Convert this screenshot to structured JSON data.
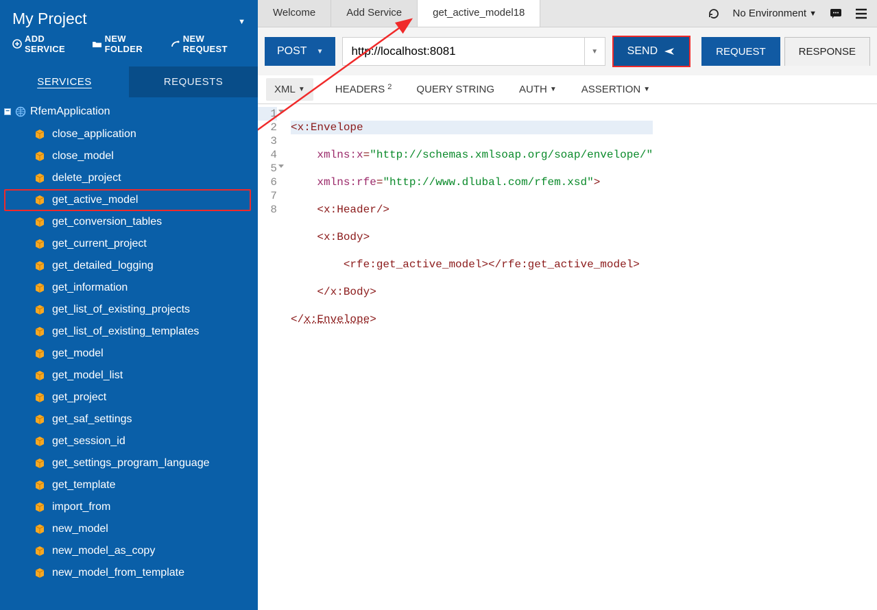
{
  "sidebar": {
    "project_title": "My Project",
    "actions": {
      "add_service": "ADD SERVICE",
      "new_folder": "NEW FOLDER",
      "new_request": "NEW REQUEST"
    },
    "tabs": {
      "services": "SERVICES",
      "requests": "REQUESTS"
    },
    "root": "RfemApplication",
    "items": [
      "close_application",
      "close_model",
      "delete_project",
      "get_active_model",
      "get_conversion_tables",
      "get_current_project",
      "get_detailed_logging",
      "get_information",
      "get_list_of_existing_projects",
      "get_list_of_existing_templates",
      "get_model",
      "get_model_list",
      "get_project",
      "get_saf_settings",
      "get_session_id",
      "get_settings_program_language",
      "get_template",
      "import_from",
      "new_model",
      "new_model_as_copy",
      "new_model_from_template"
    ],
    "highlight_index": 3
  },
  "topbar": {
    "tabs": [
      "Welcome",
      "Add Service",
      "get_active_model18"
    ],
    "active_index": 2,
    "environment": "No Environment"
  },
  "request": {
    "method": "POST",
    "url": "http://localhost:8081",
    "send_label": "SEND",
    "rr_tabs": {
      "request": "REQUEST",
      "response": "RESPONSE"
    },
    "body_tabs": {
      "xml": "XML",
      "headers": "HEADERS",
      "headers_count": "2",
      "query": "QUERY STRING",
      "auth": "AUTH",
      "assertion": "ASSERTION"
    }
  },
  "editor": {
    "lines": {
      "l1a": "<",
      "l1b": "x:Envelope",
      "l2a": "    ",
      "l2b": "xmlns:x",
      "l2c": "=",
      "l2d": "\"http://schemas.xmlsoap.org/soap/envelope/\"",
      "l3a": "    ",
      "l3b": "xmlns:rfe",
      "l3c": "=",
      "l3d": "\"http://www.dlubal.com/rfem.xsd\"",
      "l3e": ">",
      "l4a": "    <",
      "l4b": "x:Header",
      "l4c": "/>",
      "l5a": "    <",
      "l5b": "x:Body",
      "l5c": ">",
      "l6a": "        <",
      "l6b": "rfe:get_active_model",
      "l6c": "></",
      "l6d": "rfe:get_active_model",
      "l6e": ">",
      "l7a": "    </",
      "l7b": "x:Body",
      "l7c": ">",
      "l8a": "</",
      "l8b": "x:Envelope",
      "l8c": ">"
    },
    "line_numbers": [
      "1",
      "2",
      "3",
      "4",
      "5",
      "6",
      "7",
      "8"
    ]
  }
}
